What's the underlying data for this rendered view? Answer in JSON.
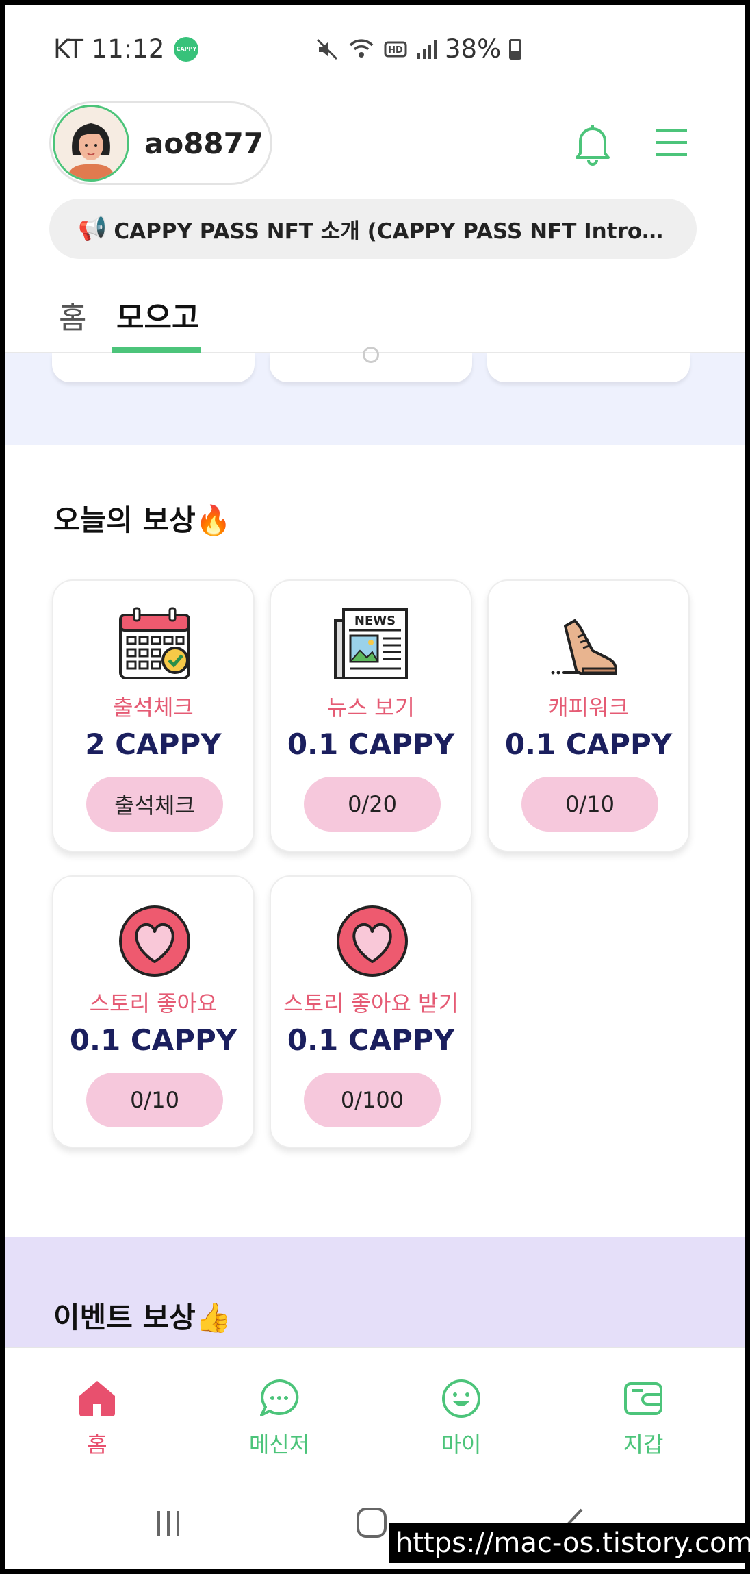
{
  "status_bar": {
    "carrier_time": "KT 11:12",
    "app_badge": "CAPPY",
    "battery": "38%"
  },
  "header": {
    "username": "ao8877",
    "notice": "CAPPY PASS NFT 소개 (CAPPY PASS NFT Introducti…"
  },
  "tabs": [
    {
      "label": "홈"
    },
    {
      "label": "모으고"
    }
  ],
  "today_rewards": {
    "title": "오늘의 보상🔥",
    "cards": [
      {
        "icon": "calendar-check-icon",
        "label": "출석체크",
        "amount": "2 CAPPY",
        "button": "출석체크"
      },
      {
        "icon": "news-icon",
        "label": "뉴스 보기",
        "amount": "0.1 CAPPY",
        "button": "0/20"
      },
      {
        "icon": "sneaker-icon",
        "label": "캐피워크",
        "amount": "0.1 CAPPY",
        "button": "0/10"
      },
      {
        "icon": "heart-icon",
        "label": "스토리 좋아요",
        "amount": "0.1 CAPPY",
        "button": "0/10"
      },
      {
        "icon": "heart-icon",
        "label": "스토리 좋아요 받기",
        "amount": "0.1 CAPPY",
        "button": "0/100"
      }
    ]
  },
  "event_rewards": {
    "title": "이벤트 보상👍"
  },
  "bottom_nav": [
    {
      "label": "홈",
      "icon": "home-icon",
      "active": true
    },
    {
      "label": "메신저",
      "icon": "chat-icon",
      "active": false
    },
    {
      "label": "마이",
      "icon": "smile-icon",
      "active": false
    },
    {
      "label": "지갑",
      "icon": "wallet-icon",
      "active": false
    }
  ],
  "watermark": "https://mac-os.tistory.com",
  "colors": {
    "accent_green": "#4cc47a",
    "accent_pink": "#e55b74",
    "button_pink": "#f6c8dc",
    "amount_navy": "#1b1f5e",
    "band_blue": "#eef1fd",
    "band_purple": "#e5dff9"
  }
}
